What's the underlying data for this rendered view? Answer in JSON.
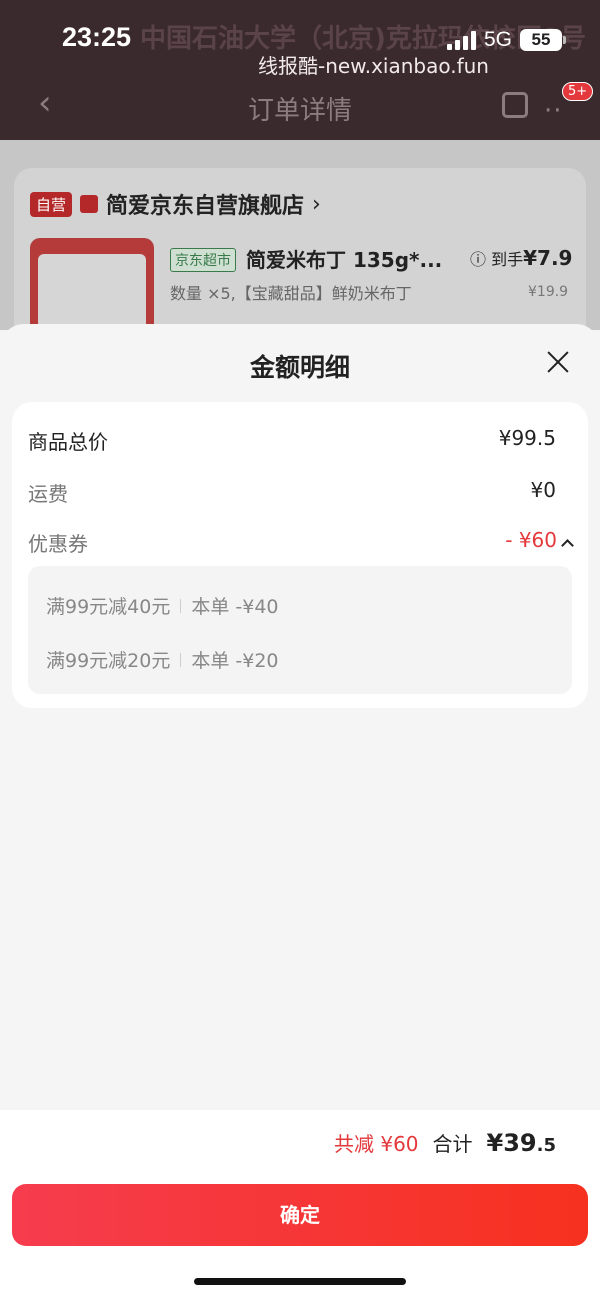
{
  "status": {
    "time": "23:25",
    "network": "5G",
    "battery": "55"
  },
  "watermark": "线报酷-new.xianbao.fun",
  "header": {
    "title": "订单详情",
    "badge": "5+",
    "ghost_text": "中国石油大学（北京)克拉玛依校区9号"
  },
  "order": {
    "self_tag": "自营",
    "store_name": "简爱京东自营旗舰店",
    "store_arrow": "›",
    "market_tag": "京东超市",
    "product_name": "简爱米布丁 135g*...",
    "price_prefix": "到手",
    "price": "¥7.9",
    "quantity": "数量 ×5,【宝藏甜品】鲜奶米布丁",
    "original_price": "¥19.9"
  },
  "sheet": {
    "title": "金额明细",
    "rows": [
      {
        "label": "商品总价",
        "value": "¥99.5"
      },
      {
        "label": "运费",
        "value": "¥0"
      },
      {
        "label": "优惠券",
        "value": "- ¥60"
      }
    ],
    "coupons": [
      {
        "rule": "满99元减40元",
        "discount": "本单 -¥40"
      },
      {
        "rule": "满99元减20元",
        "discount": "本单 -¥20"
      }
    ]
  },
  "footer": {
    "saved": "共减 ¥60",
    "total_label": "合计",
    "total_int": "¥39",
    "total_dec": ".5",
    "confirm": "确定"
  },
  "colors": {
    "accent": "#e4393c",
    "button_from": "#f63c4e",
    "button_to": "#f7311f"
  }
}
